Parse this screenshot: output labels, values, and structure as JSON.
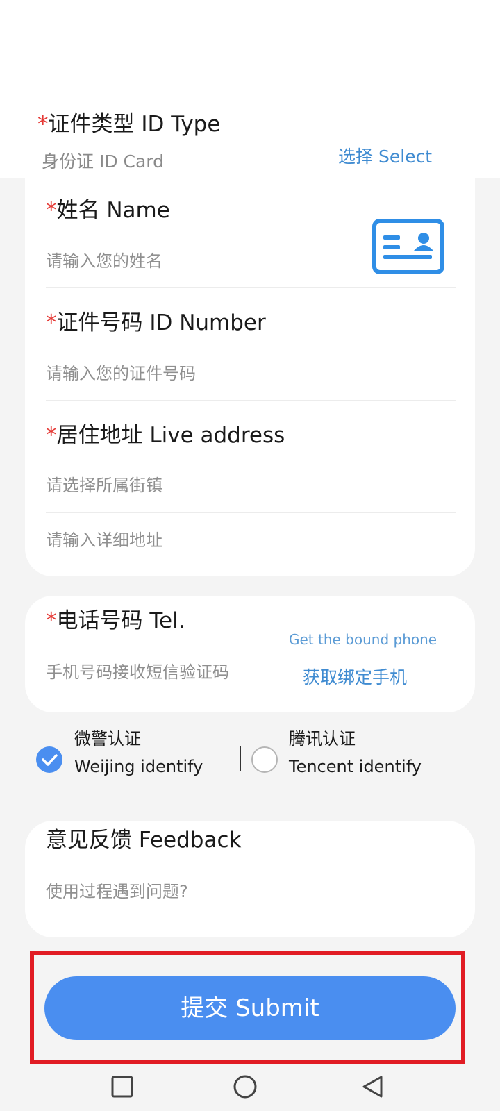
{
  "id_section": {
    "type_label": "证件类型 ID Type",
    "type_value": "身份证 ID Card",
    "select_link": "选择 Select",
    "name_label": "姓名 Name",
    "name_placeholder": "请输入您的姓名",
    "number_label": "证件号码 ID Number",
    "number_placeholder": "请输入您的证件号码",
    "address_label": "居住地址 Live address",
    "street_placeholder": "请选择所属街镇",
    "detail_placeholder": "请输入详细地址",
    "required_mark": "*"
  },
  "tel_section": {
    "label": "电话号码 Tel.",
    "placeholder": "手机号码接收短信验证码",
    "bound_phone_en": "Get the bound phone",
    "bound_phone_zh": "获取绑定手机"
  },
  "verify": {
    "options": [
      {
        "label_zh": "微警认证",
        "label_en": "Weijing identify",
        "checked": true
      },
      {
        "label_zh": "腾讯认证",
        "label_en": "Tencent identify",
        "checked": false
      }
    ],
    "separator": "|"
  },
  "feedback": {
    "label": "意见反馈 Feedback",
    "placeholder": "使用过程遇到问题?"
  },
  "submit_label": "提交 Submit",
  "colors": {
    "accent": "#4a8ef0",
    "link": "#3f8bd1",
    "required": "#e53935",
    "highlight_frame": "#e11c24"
  },
  "icons": {
    "id_card": "id-card-icon",
    "recent": "square-nav-icon",
    "home": "circle-nav-icon",
    "back": "triangle-nav-icon"
  }
}
